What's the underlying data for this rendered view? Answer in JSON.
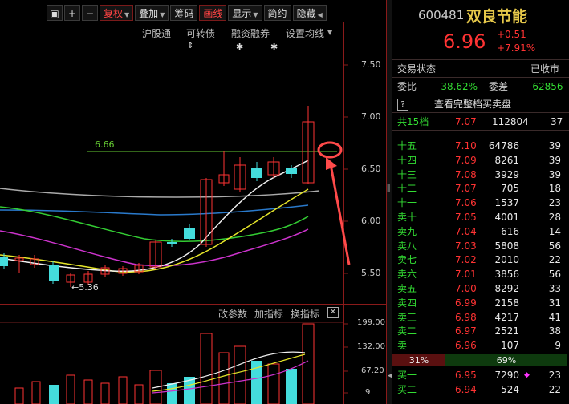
{
  "toolbar": {
    "buttons": [
      "复权",
      "叠加",
      "筹码",
      "画线",
      "显示",
      "简约",
      "隐藏"
    ]
  },
  "sub_toolbar": [
    "沪股通",
    "可转债",
    "融资融券",
    "设置均线"
  ],
  "price_axis": [
    "7.50",
    "7.00",
    "6.50",
    "6.00",
    "5.50"
  ],
  "annotations": {
    "resistance": "6.66",
    "low": "5.36"
  },
  "volume_toolbar": [
    "改参数",
    "加指标",
    "换指标"
  ],
  "volume_axis": [
    "199.00",
    "132.00",
    "67.20",
    "9"
  ],
  "stock": {
    "code": "600481",
    "name": "双良节能",
    "price": "6.96",
    "change": "+0.51",
    "change_pct": "+7.91%"
  },
  "status": {
    "label": "交易状态",
    "value": "已收市"
  },
  "ratio": {
    "label1": "委比",
    "val1": "-38.62%",
    "label2": "委差",
    "val2": "-62856"
  },
  "full_book": {
    "icon": "?",
    "label": "查看完整档买卖盘"
  },
  "total": {
    "label": "共15档",
    "price": "7.07",
    "vol": "112804",
    "cnt": "37"
  },
  "asks": [
    {
      "label": "十五",
      "price": "7.10",
      "vol": "64786",
      "cnt": "39"
    },
    {
      "label": "十四",
      "price": "7.09",
      "vol": "8261",
      "cnt": "39"
    },
    {
      "label": "十三",
      "price": "7.08",
      "vol": "3929",
      "cnt": "39"
    },
    {
      "label": "十二",
      "price": "7.07",
      "vol": "705",
      "cnt": "18"
    },
    {
      "label": "十一",
      "price": "7.06",
      "vol": "1537",
      "cnt": "23"
    },
    {
      "label": "卖十",
      "price": "7.05",
      "vol": "4001",
      "cnt": "28"
    },
    {
      "label": "卖九",
      "price": "7.04",
      "vol": "616",
      "cnt": "14"
    },
    {
      "label": "卖八",
      "price": "7.03",
      "vol": "5808",
      "cnt": "56"
    },
    {
      "label": "卖七",
      "price": "7.02",
      "vol": "2010",
      "cnt": "22"
    },
    {
      "label": "卖六",
      "price": "7.01",
      "vol": "3856",
      "cnt": "56"
    },
    {
      "label": "卖五",
      "price": "7.00",
      "vol": "8292",
      "cnt": "33"
    },
    {
      "label": "卖四",
      "price": "6.99",
      "vol": "2158",
      "cnt": "31"
    },
    {
      "label": "卖三",
      "price": "6.98",
      "vol": "4217",
      "cnt": "41"
    },
    {
      "label": "卖二",
      "price": "6.97",
      "vol": "2521",
      "cnt": "38"
    },
    {
      "label": "卖一",
      "price": "6.96",
      "vol": "107",
      "cnt": "9"
    }
  ],
  "ratio_bar": {
    "left": "31%",
    "right": "69%"
  },
  "bids": [
    {
      "label": "买一",
      "price": "6.95",
      "vol": "7290",
      "cnt": "23"
    },
    {
      "label": "买二",
      "price": "6.94",
      "vol": "524",
      "cnt": "22"
    }
  ]
}
